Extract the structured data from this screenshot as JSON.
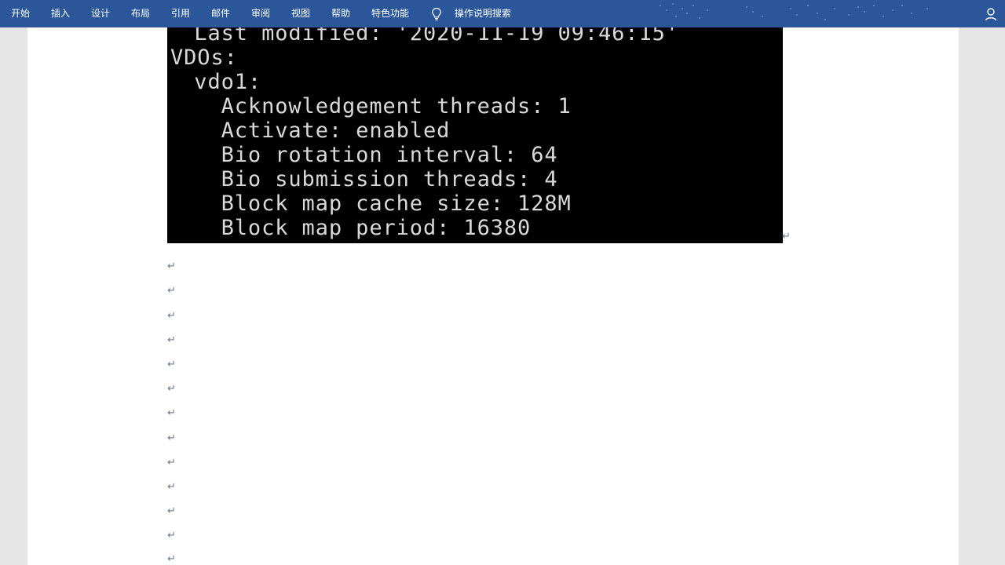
{
  "ribbon": {
    "tabs": [
      "开始",
      "插入",
      "设计",
      "布局",
      "引用",
      "邮件",
      "审阅",
      "视图",
      "帮助",
      "特色功能"
    ],
    "tell_me": "操作说明搜索",
    "icons": {
      "tell_me": "lightbulb-icon",
      "account": "user-icon"
    },
    "color": "#2b579a"
  },
  "terminal": {
    "lines": [
      "  Last modified: '2020-11-19 09:46:15'",
      "VDOs:",
      "  vdo1:",
      "    Acknowledgement threads: 1",
      "    Activate: enabled",
      "    Bio rotation interval: 64",
      "    Bio submission threads: 4",
      "    Block map cache size: 128M",
      "    Block map period: 16380"
    ]
  },
  "document": {
    "paragraph_mark": "↵",
    "empty_paragraph_count": 13
  }
}
